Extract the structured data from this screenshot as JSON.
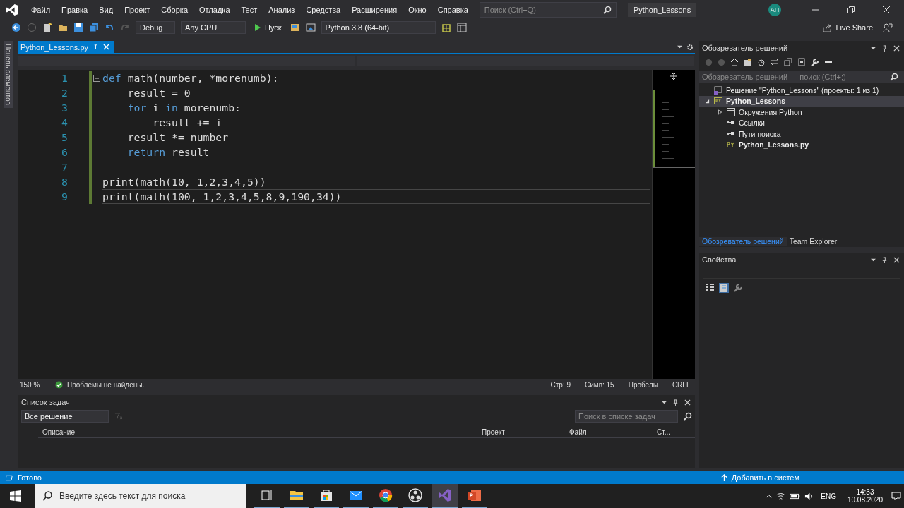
{
  "menu": [
    "Файл",
    "Правка",
    "Вид",
    "Проект",
    "Сборка",
    "Отладка",
    "Тест",
    "Анализ",
    "Средства",
    "Расширения",
    "Окно",
    "Справка"
  ],
  "search": {
    "placeholder": "Поиск (Ctrl+Q)"
  },
  "solution_name": "Python_Lessons",
  "avatar": "АП",
  "toolbar": {
    "config": "Debug",
    "platform": "Any CPU",
    "run": "Пуск",
    "environment": "Python 3.8 (64-bit)",
    "live_share": "Live Share"
  },
  "side_tab": "Панель элементов",
  "editor": {
    "tabs": [
      {
        "label": "Python_Lessons.py",
        "selected": true
      }
    ],
    "lines": [
      {
        "number": "1",
        "current": false,
        "tokens": [
          {
            "kind": "kw",
            "text": "def"
          },
          {
            "kind": "plain",
            "text": " math(number, *morenumb):"
          }
        ]
      },
      {
        "number": "2",
        "current": false,
        "tokens": [
          {
            "kind": "plain",
            "text": "    result = 0"
          }
        ]
      },
      {
        "number": "3",
        "current": false,
        "tokens": [
          {
            "kind": "kw",
            "text": "    for"
          },
          {
            "kind": "plain",
            "text": " i "
          },
          {
            "kind": "kw",
            "text": "in"
          },
          {
            "kind": "plain",
            "text": " morenumb:"
          }
        ]
      },
      {
        "number": "4",
        "current": false,
        "tokens": [
          {
            "kind": "plain",
            "text": "        result += i"
          }
        ]
      },
      {
        "number": "5",
        "current": false,
        "tokens": [
          {
            "kind": "plain",
            "text": "    result *= number"
          }
        ]
      },
      {
        "number": "6",
        "current": false,
        "tokens": [
          {
            "kind": "kw",
            "text": "    return"
          },
          {
            "kind": "plain",
            "text": " result"
          }
        ]
      },
      {
        "number": "7",
        "current": false
      },
      {
        "number": "8",
        "current": false,
        "tokens": [
          {
            "kind": "plain",
            "text": "print(math(10, 1,2,3,4,5))"
          }
        ]
      },
      {
        "number": "9",
        "current": true,
        "tokens": [
          {
            "kind": "plain",
            "text": "print(math(100, 1,2,3,4,5,8,9,190,34))"
          }
        ]
      }
    ],
    "zoom": "150 %",
    "status": "Проблемы не найдены.",
    "position": [
      "Стр: 9",
      "Симв: 15",
      "Пробелы",
      "CRLF"
    ]
  },
  "task_list": {
    "title": "Список задач",
    "filter": "Все решение",
    "search": {
      "placeholder": "Поиск в списке задач"
    },
    "columns": [
      "Описание",
      "Проект",
      "Файл",
      "Ст..."
    ]
  },
  "solution_explorer": {
    "title": "Обозреватель решений",
    "search": {
      "placeholder": "Обозреватель решений — поиск (Ctrl+;)"
    },
    "tree": [
      {
        "label": "Решение \"Python_Lessons\" (проекты: 1 из 1)",
        "kind": "solution",
        "selected": false,
        "children": [
          {
            "label": "Python_Lessons",
            "kind": "project",
            "selected": true,
            "expanded": true,
            "children": [
              {
                "label": "Окружения Python",
                "kind": "environments",
                "selected": false,
                "expanded": false
              },
              {
                "label": "Ссылки",
                "kind": "references",
                "selected": false
              },
              {
                "label": "Пути поиска",
                "kind": "references",
                "selected": false
              },
              {
                "label": "Python_Lessons.py",
                "kind": "pyfile",
                "selected": false
              }
            ]
          }
        ]
      }
    ],
    "tabs": [
      {
        "label": "Обозреватель решений",
        "selected": true
      },
      {
        "label": "Team Explorer",
        "selected": false
      }
    ]
  },
  "properties": {
    "title": "Свойства"
  },
  "status_bar": {
    "text": "Готово",
    "action": "Добавить в систем"
  },
  "taskbar": {
    "search": {
      "placeholder": "Введите здесь текст для поиска"
    },
    "apps": [
      {
        "kind": "taskview",
        "active": false
      },
      {
        "kind": "explorer",
        "active": false
      },
      {
        "kind": "store",
        "active": false
      },
      {
        "kind": "mail",
        "active": false
      },
      {
        "kind": "chrome",
        "active": false
      },
      {
        "kind": "obs",
        "active": false
      },
      {
        "kind": "vs",
        "active": true
      },
      {
        "kind": "powerpoint",
        "active": false
      }
    ],
    "language": "ENG",
    "time": "14:33",
    "date": "10.08.2020"
  }
}
